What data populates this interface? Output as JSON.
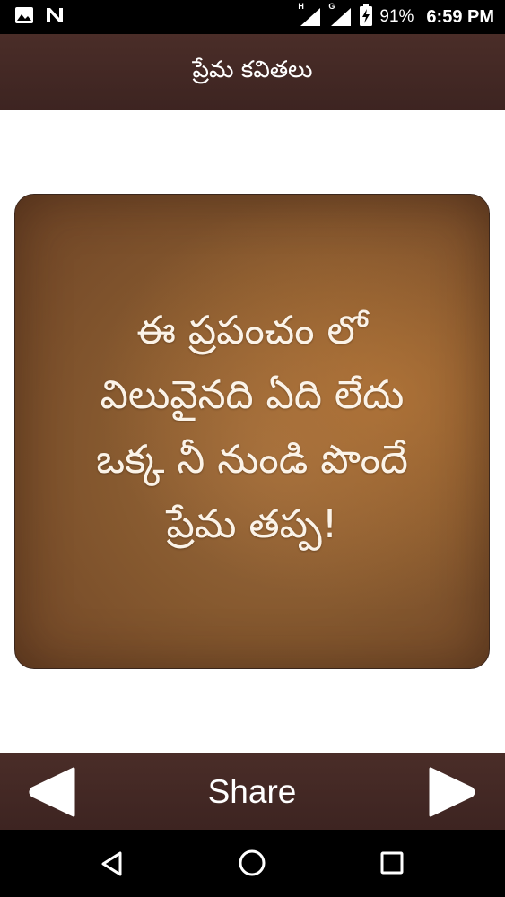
{
  "status_bar": {
    "battery_percent": "91%",
    "time": "6:59 PM",
    "network_1": "H",
    "network_2": "G",
    "left_icons": [
      "image-icon",
      "n-logo-icon"
    ]
  },
  "header": {
    "title": "ప్రేమ కవితలు"
  },
  "quote": {
    "lines": [
      "ఈ ప్రపంచం లో",
      "విలువైనది ఏది లేదు",
      "ఒక్క నీ నుండి పొందే",
      "ప్రేమ తప్ప!"
    ]
  },
  "actions": {
    "share_label": "Share",
    "prev_icon": "left-arrow-icon",
    "next_icon": "right-arrow-icon"
  },
  "nav_bar": {
    "icons": [
      "back-icon",
      "home-icon",
      "recent-apps-icon"
    ]
  },
  "colors": {
    "bar": "#3f2622",
    "card": "#86592f",
    "text_light": "#ffffff"
  }
}
